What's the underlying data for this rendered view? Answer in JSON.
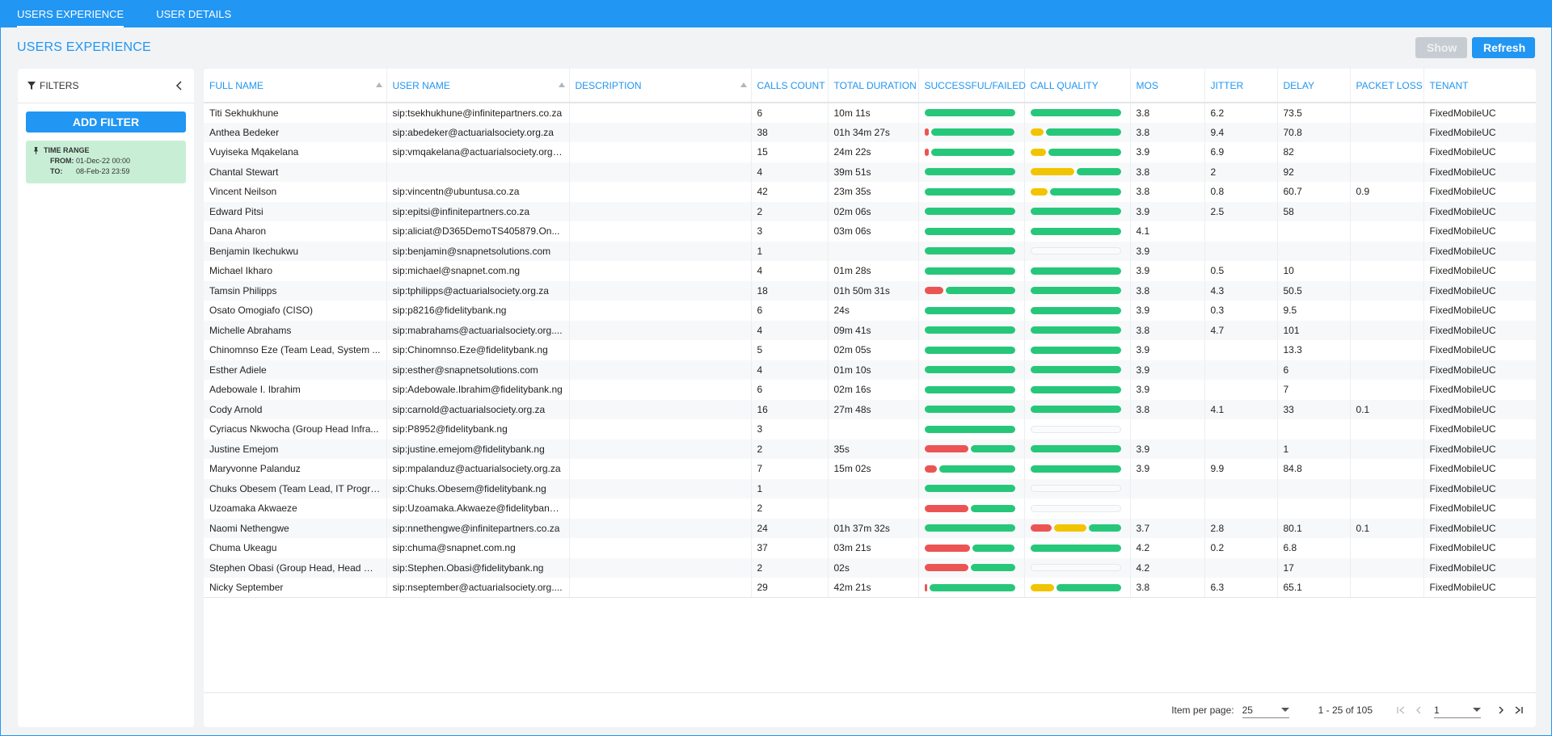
{
  "tabs": [
    {
      "label": "USERS EXPERIENCE",
      "active": true
    },
    {
      "label": "USER DETAILS",
      "active": false
    }
  ],
  "page_title": "USERS EXPERIENCE",
  "actions": {
    "show_label": "Show",
    "refresh_label": "Refresh"
  },
  "sidebar": {
    "title": "FILTERS",
    "add_filter_label": "ADD FILTER",
    "time_range": {
      "title": "TIME RANGE",
      "from_label": "FROM:",
      "from_value": "01-Dec-22 00:00",
      "to_label": "TO:",
      "to_value": "08-Feb-23 23:59"
    }
  },
  "columns": [
    "FULL NAME",
    "USER NAME",
    "DESCRIPTION",
    "CALLS COUNT",
    "TOTAL DURATION",
    "SUCCESSFUL/FAILED",
    "CALL QUALITY",
    "MOS",
    "JITTER",
    "DELAY",
    "PACKET LOSS",
    "TENANT"
  ],
  "colors": {
    "accent": "#2196f3",
    "good": "#27c77a",
    "bad": "#ec5454",
    "warn": "#f2c400"
  },
  "rows": [
    {
      "name": "Titi Sekhukhune",
      "user": "sip:tsekhukhune@infinitepartners.co.za",
      "desc": "",
      "calls": "6",
      "duration": "10m 11s",
      "sf": {
        "r": 0,
        "g": 1
      },
      "cq": {
        "r": 0,
        "y": 0,
        "g": 1
      },
      "mos": "3.8",
      "jitter": "6.2",
      "delay": "73.5",
      "loss": "",
      "tenant": "FixedMobileUC"
    },
    {
      "name": "Anthea Bedeker",
      "user": "sip:abedeker@actuarialsociety.org.za",
      "desc": "",
      "calls": "38",
      "duration": "01h 34m 27s",
      "sf": {
        "r": 0.05,
        "g": 0.95
      },
      "cq": {
        "r": 0,
        "y": 0.15,
        "g": 0.85
      },
      "mos": "3.8",
      "jitter": "9.4",
      "delay": "70.8",
      "loss": "",
      "tenant": "FixedMobileUC"
    },
    {
      "name": "Vuyiseka Mqakelana",
      "user": "sip:vmqakelana@actuarialsociety.org....",
      "desc": "",
      "calls": "15",
      "duration": "24m 22s",
      "sf": {
        "r": 0.05,
        "g": 0.95
      },
      "cq": {
        "r": 0,
        "y": 0.18,
        "g": 0.82
      },
      "mos": "3.9",
      "jitter": "6.9",
      "delay": "82",
      "loss": "",
      "tenant": "FixedMobileUC"
    },
    {
      "name": "Chantal Stewart",
      "user": "",
      "desc": "",
      "calls": "4",
      "duration": "39m 51s",
      "sf": {
        "r": 0,
        "g": 1
      },
      "cq": {
        "r": 0,
        "y": 0.5,
        "g": 0.5
      },
      "mos": "3.8",
      "jitter": "2",
      "delay": "92",
      "loss": "",
      "tenant": "FixedMobileUC"
    },
    {
      "name": "Vincent Neilson",
      "user": "sip:vincentn@ubuntusa.co.za",
      "desc": "",
      "calls": "42",
      "duration": "23m 35s",
      "sf": {
        "r": 0,
        "g": 1
      },
      "cq": {
        "r": 0,
        "y": 0.2,
        "g": 0.8
      },
      "mos": "3.8",
      "jitter": "0.8",
      "delay": "60.7",
      "loss": "0.9",
      "tenant": "FixedMobileUC"
    },
    {
      "name": "Edward Pitsi",
      "user": "sip:epitsi@infinitepartners.co.za",
      "desc": "",
      "calls": "2",
      "duration": "02m 06s",
      "sf": {
        "r": 0,
        "g": 1
      },
      "cq": {
        "r": 0,
        "y": 0,
        "g": 1
      },
      "mos": "3.9",
      "jitter": "2.5",
      "delay": "58",
      "loss": "",
      "tenant": "FixedMobileUC"
    },
    {
      "name": "Dana Aharon",
      "user": "sip:aliciat@D365DemoTS405879.On...",
      "desc": "",
      "calls": "3",
      "duration": "03m 06s",
      "sf": {
        "r": 0,
        "g": 1
      },
      "cq": {
        "r": 0,
        "y": 0,
        "g": 1
      },
      "mos": "4.1",
      "jitter": "",
      "delay": "",
      "loss": "",
      "tenant": "FixedMobileUC"
    },
    {
      "name": "Benjamin Ikechukwu",
      "user": "sip:benjamin@snapnetsolutions.com",
      "desc": "",
      "calls": "1",
      "duration": "",
      "sf": {
        "r": 0,
        "g": 1
      },
      "cq": null,
      "mos": "3.9",
      "jitter": "",
      "delay": "",
      "loss": "",
      "tenant": "FixedMobileUC"
    },
    {
      "name": "Michael Ikharo",
      "user": "sip:michael@snapnet.com.ng",
      "desc": "",
      "calls": "4",
      "duration": "01m 28s",
      "sf": {
        "r": 0,
        "g": 1
      },
      "cq": {
        "r": 0,
        "y": 0,
        "g": 1
      },
      "mos": "3.9",
      "jitter": "0.5",
      "delay": "10",
      "loss": "",
      "tenant": "FixedMobileUC"
    },
    {
      "name": "Tamsin Philipps",
      "user": "sip:tphilipps@actuarialsociety.org.za",
      "desc": "",
      "calls": "18",
      "duration": "01h 50m 31s",
      "sf": {
        "r": 0.22,
        "g": 0.78
      },
      "cq": {
        "r": 0,
        "y": 0,
        "g": 1
      },
      "mos": "3.8",
      "jitter": "4.3",
      "delay": "50.5",
      "loss": "",
      "tenant": "FixedMobileUC"
    },
    {
      "name": "Osato Omogiafo (CISO)",
      "user": "sip:p8216@fidelitybank.ng",
      "desc": "",
      "calls": "6",
      "duration": "24s",
      "sf": {
        "r": 0,
        "g": 1
      },
      "cq": {
        "r": 0,
        "y": 0,
        "g": 1
      },
      "mos": "3.9",
      "jitter": "0.3",
      "delay": "9.5",
      "loss": "",
      "tenant": "FixedMobileUC"
    },
    {
      "name": "Michelle Abrahams",
      "user": "sip:mabrahams@actuarialsociety.org....",
      "desc": "",
      "calls": "4",
      "duration": "09m 41s",
      "sf": {
        "r": 0,
        "g": 1
      },
      "cq": {
        "r": 0,
        "y": 0,
        "g": 1
      },
      "mos": "3.8",
      "jitter": "4.7",
      "delay": "101",
      "loss": "",
      "tenant": "FixedMobileUC"
    },
    {
      "name": "Chinomnso Eze (Team Lead, System ...",
      "user": "sip:Chinomnso.Eze@fidelitybank.ng",
      "desc": "",
      "calls": "5",
      "duration": "02m 05s",
      "sf": {
        "r": 0,
        "g": 1
      },
      "cq": {
        "r": 0,
        "y": 0,
        "g": 1
      },
      "mos": "3.9",
      "jitter": "",
      "delay": "13.3",
      "loss": "",
      "tenant": "FixedMobileUC"
    },
    {
      "name": "Esther Adiele",
      "user": "sip:esther@snapnetsolutions.com",
      "desc": "",
      "calls": "4",
      "duration": "01m 10s",
      "sf": {
        "r": 0,
        "g": 1
      },
      "cq": {
        "r": 0,
        "y": 0,
        "g": 1
      },
      "mos": "3.9",
      "jitter": "",
      "delay": "6",
      "loss": "",
      "tenant": "FixedMobileUC"
    },
    {
      "name": "Adebowale I. Ibrahim",
      "user": "sip:Adebowale.Ibrahim@fidelitybank.ng",
      "desc": "",
      "calls": "6",
      "duration": "02m 16s",
      "sf": {
        "r": 0,
        "g": 1
      },
      "cq": {
        "r": 0,
        "y": 0,
        "g": 1
      },
      "mos": "3.9",
      "jitter": "",
      "delay": "7",
      "loss": "",
      "tenant": "FixedMobileUC"
    },
    {
      "name": "Cody Arnold",
      "user": "sip:carnold@actuarialsociety.org.za",
      "desc": "",
      "calls": "16",
      "duration": "27m 48s",
      "sf": {
        "r": 0,
        "g": 1
      },
      "cq": {
        "r": 0,
        "y": 0,
        "g": 1
      },
      "mos": "3.8",
      "jitter": "4.1",
      "delay": "33",
      "loss": "0.1",
      "tenant": "FixedMobileUC"
    },
    {
      "name": "Cyriacus Nkwocha (Group Head Infra...",
      "user": "sip:P8952@fidelitybank.ng",
      "desc": "",
      "calls": "3",
      "duration": "",
      "sf": {
        "r": 0,
        "g": 1
      },
      "cq": null,
      "mos": "",
      "jitter": "",
      "delay": "",
      "loss": "",
      "tenant": "FixedMobileUC"
    },
    {
      "name": "Justine Emejom",
      "user": "sip:justine.emejom@fidelitybank.ng",
      "desc": "",
      "calls": "2",
      "duration": "35s",
      "sf": {
        "r": 0.5,
        "g": 0.5
      },
      "cq": {
        "r": 0,
        "y": 0,
        "g": 1
      },
      "mos": "3.9",
      "jitter": "",
      "delay": "1",
      "loss": "",
      "tenant": "FixedMobileUC"
    },
    {
      "name": "Maryvonne Palanduz",
      "user": "sip:mpalanduz@actuarialsociety.org.za",
      "desc": "",
      "calls": "7",
      "duration": "15m 02s",
      "sf": {
        "r": 0.14,
        "g": 0.86
      },
      "cq": {
        "r": 0,
        "y": 0,
        "g": 1
      },
      "mos": "3.9",
      "jitter": "9.9",
      "delay": "84.8",
      "loss": "",
      "tenant": "FixedMobileUC"
    },
    {
      "name": "Chuks Obesem (Team Lead, IT Progra...",
      "user": "sip:Chuks.Obesem@fidelitybank.ng",
      "desc": "",
      "calls": "1",
      "duration": "",
      "sf": {
        "r": 0,
        "g": 1
      },
      "cq": null,
      "mos": "",
      "jitter": "",
      "delay": "",
      "loss": "",
      "tenant": "FixedMobileUC"
    },
    {
      "name": "Uzoamaka Akwaeze",
      "user": "sip:Uzoamaka.Akwaeze@fidelitybank....",
      "desc": "",
      "calls": "2",
      "duration": "",
      "sf": {
        "r": 0.5,
        "g": 0.5
      },
      "cq": null,
      "mos": "",
      "jitter": "",
      "delay": "",
      "loss": "",
      "tenant": "FixedMobileUC"
    },
    {
      "name": "Naomi Nethengwe",
      "user": "sip:nnethengwe@infinitepartners.co.za",
      "desc": "",
      "calls": "24",
      "duration": "01h 37m 32s",
      "sf": {
        "r": 0,
        "g": 1
      },
      "cq": {
        "r": 0.25,
        "y": 0.38,
        "g": 0.37
      },
      "mos": "3.7",
      "jitter": "2.8",
      "delay": "80.1",
      "loss": "0.1",
      "tenant": "FixedMobileUC"
    },
    {
      "name": "Chuma Ukeagu",
      "user": "sip:chuma@snapnet.com.ng",
      "desc": "",
      "calls": "37",
      "duration": "03m 21s",
      "sf": {
        "r": 0.52,
        "g": 0.48
      },
      "cq": {
        "r": 0,
        "y": 0,
        "g": 1
      },
      "mos": "4.2",
      "jitter": "0.2",
      "delay": "6.8",
      "loss": "",
      "tenant": "FixedMobileUC"
    },
    {
      "name": "Stephen Obasi (Group Head, Head Off...",
      "user": "sip:Stephen.Obasi@fidelitybank.ng",
      "desc": "",
      "calls": "2",
      "duration": "02s",
      "sf": {
        "r": 0.5,
        "g": 0.5
      },
      "cq": null,
      "mos": "4.2",
      "jitter": "",
      "delay": "17",
      "loss": "",
      "tenant": "FixedMobileUC"
    },
    {
      "name": "Nicky September",
      "user": "sip:nseptember@actuarialsociety.org....",
      "desc": "",
      "calls": "29",
      "duration": "42m 21s",
      "sf": {
        "r": 0.03,
        "g": 0.97
      },
      "cq": {
        "r": 0,
        "y": 0.27,
        "g": 0.73
      },
      "mos": "3.8",
      "jitter": "6.3",
      "delay": "65.1",
      "loss": "",
      "tenant": "FixedMobileUC"
    }
  ],
  "footer": {
    "items_per_page_label": "Item per page:",
    "items_per_page_value": "25",
    "range_text": "1 - 25 of 105",
    "page_value": "1"
  }
}
